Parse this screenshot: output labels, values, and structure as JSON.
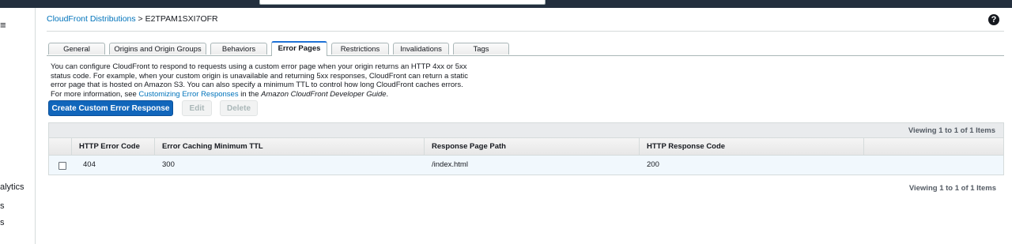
{
  "sidebar": {
    "toggle_icon": "≡",
    "items": [
      {
        "label": "alytics"
      },
      {
        "label": "s"
      },
      {
        "label": "s"
      }
    ]
  },
  "breadcrumb": {
    "root_link": "CloudFront Distributions",
    "separator": " > ",
    "current": "E2TPAM1SXI7OFR"
  },
  "help_icon": "?",
  "tabs": [
    {
      "label": "General"
    },
    {
      "label": "Origins and Origin Groups"
    },
    {
      "label": "Behaviors"
    },
    {
      "label": "Error Pages",
      "active": true
    },
    {
      "label": "Restrictions"
    },
    {
      "label": "Invalidations"
    },
    {
      "label": "Tags"
    }
  ],
  "description": {
    "line1": "You can configure CloudFront to respond to requests using a custom error page when your origin returns an HTTP 4xx or 5xx",
    "line2": "status code. For example, when your custom origin is unavailable and returning 5xx responses, CloudFront can return a static",
    "line3": "error page that is hosted on Amazon S3. You can also specify a minimum TTL to control how long CloudFront caches errors.",
    "line4_prefix": "For more information, see ",
    "line4_link": "Customizing Error Responses",
    "line4_mid": " in the ",
    "line4_guide": "Amazon CloudFront Developer Guide",
    "line4_suffix": "."
  },
  "buttons": {
    "create": "Create Custom Error Response",
    "edit": "Edit",
    "delete": "Delete"
  },
  "table": {
    "viewing_top": "Viewing 1 to 1 of 1 Items",
    "viewing_bottom": "Viewing 1 to 1 of 1 Items",
    "headers": [
      "HTTP Error Code",
      "Error Caching Minimum TTL",
      "Response Page Path",
      "HTTP Response Code"
    ],
    "rows": [
      {
        "error_code": "404",
        "ttl": "300",
        "path": "/index.html",
        "response_code": "200"
      }
    ]
  },
  "colors": {
    "topbar": "#232f3e",
    "primary_button": "#1166bb",
    "link": "#0073bb",
    "active_tab_border": "#1e72d6",
    "selected_row": "#f1f8fd"
  }
}
